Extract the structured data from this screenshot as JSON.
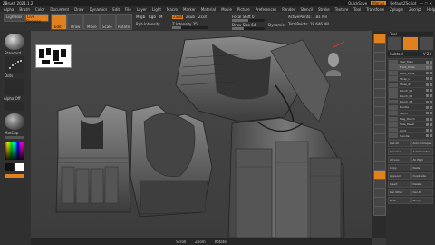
{
  "title_bar": {
    "app_title": "ZBrush 2021.1.2",
    "quicksave": "QuickSave",
    "menus_button": "Menus",
    "default_button": "DefaultZScript"
  },
  "menu": [
    "Alpha",
    "Brush",
    "Color",
    "Document",
    "Draw",
    "Dynamics",
    "Edit",
    "File",
    "Layer",
    "Light",
    "Macro",
    "Marker",
    "Material",
    "Movie",
    "Picture",
    "Preferences",
    "Render",
    "Stencil",
    "Stroke",
    "Texture",
    "Tool",
    "Transform",
    "Zplugin",
    "Zscript",
    "Help"
  ],
  "toolbar": {
    "lightbox": "LightBox",
    "live_boolean": "Live Boolean",
    "edit": "Edit",
    "draw": "Draw",
    "move": "Move",
    "scale": "Scale",
    "rotate": "Rotate",
    "mrgb": "Mrgb",
    "rgb": "Rgb",
    "m": "M",
    "zadd": "Zadd",
    "zsub": "Zsub",
    "zcut": "Zcut",
    "focal_shift": "Focal Shift 0",
    "draw_size": "Draw Size 64",
    "dynamic": "Dynamic",
    "active_points": "ActivePoints: 7.81 Mil",
    "total_points": "TotalPoints: 19.646 Mil",
    "rgb_intensity": "Rgb Intensity",
    "z_intensity": "Z Intensity 25",
    "z_intensity_level": 0.25
  },
  "left_shelf": {
    "labels": [
      "Standard",
      "Dots",
      "Alpha Off",
      "MatCap",
      "Gradient",
      "SwitchColor",
      "Alternate"
    ]
  },
  "right_tools": [
    "BPR",
    "SPix 3",
    "Scroll",
    "Zoom",
    "Actual",
    "AAHalf",
    "Persp",
    "Floor",
    "Local",
    "L.Sym",
    "Frame",
    "Move",
    "Zoom3D",
    "Rotate",
    "Line Fill",
    "PolyF",
    "Transp",
    "Ghost",
    "Solo",
    "Xpose"
  ],
  "subtool_panel": {
    "header": "Tool",
    "section": "Subtool",
    "visible_count": "V 24",
    "items": [
      "Vest_Main",
      "Front_Plate",
      "Back_Plate",
      "Strap_L",
      "Strap_R",
      "Pouch_01",
      "Pouch_02",
      "Pouch_03",
      "Buckle",
      "Velcro",
      "Mag_Pouch",
      "Side_Panel",
      "Cord",
      "Handle"
    ],
    "buttons": [
      "List All",
      "Auto Collapse",
      "Rename",
      "AutoReorder",
      "All Low",
      "All High",
      "Copy",
      "Paste",
      "Append",
      "Duplicate",
      "Insert",
      "Delete",
      "Del Other",
      "Del All",
      "Split",
      "Merge"
    ]
  },
  "bottom_bar": [
    "Scroll",
    "Zoom",
    "Rotate"
  ]
}
